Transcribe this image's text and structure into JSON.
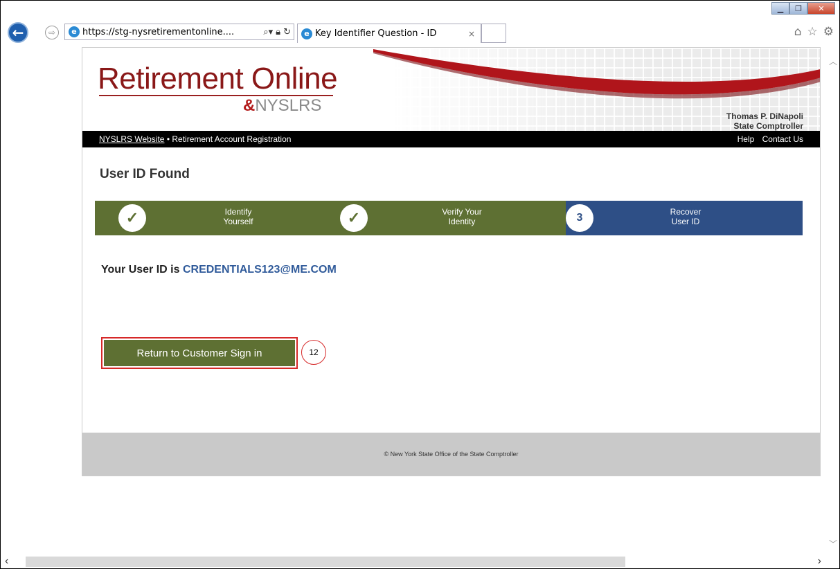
{
  "browser": {
    "url": "https://stg-nysretirementonline....",
    "tab_title": "Key Identifier Question - ID",
    "tab_close": "×"
  },
  "banner": {
    "title": "Retirement Online",
    "subtitle": "NYSLRS",
    "comptroller_name": "Thomas P. DiNapoli",
    "comptroller_title": "State Comptroller",
    "brand_color": "#8a1818"
  },
  "nav": {
    "website_link": "NYSLRS Website",
    "separator": " • ",
    "section": "Retirement Account Registration",
    "help": "Help",
    "contact": "Contact Us"
  },
  "heading": "User ID Found",
  "steps": [
    {
      "label_line1": "Identify",
      "label_line2": "Yourself",
      "status": "complete",
      "icon": "check-icon"
    },
    {
      "label_line1": "Verify Your",
      "label_line2": "Identity",
      "status": "complete",
      "icon": "check-icon"
    },
    {
      "number": "3",
      "label_line1": "Recover",
      "label_line2": "User ID",
      "status": "current"
    }
  ],
  "result": {
    "prefix": "Your User ID is",
    "user_id": "CREDENTIALS123@ME.COM"
  },
  "return_button": "Return to Customer Sign in",
  "callout_number": "12",
  "footer": "© New York State Office of the State Comptroller",
  "colors": {
    "green": "#5e7033",
    "blue": "#2e4f86",
    "highlight": "#d62828"
  }
}
